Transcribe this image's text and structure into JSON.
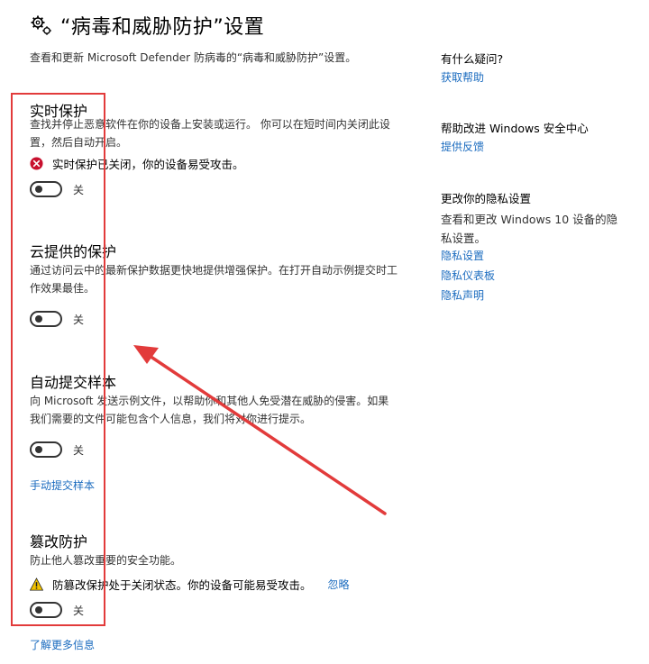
{
  "header": {
    "title": "“病毒和威胁防护”设置",
    "subtitle": "查看和更新 Microsoft Defender 防病毒的“病毒和威胁防护”设置。"
  },
  "sections": [
    {
      "title": "实时保护",
      "description": "查找并停止恶意软件在你的设备上安装或运行。 你可以在短时间内关闭此设置，然后自动开启。",
      "status": "实时保护已关闭，你的设备易受攻击。",
      "toggle_label": "关"
    },
    {
      "title": "云提供的保护",
      "description": "通过访问云中的最新保护数据更快地提供增强保护。在打开自动示例提交时工作效果最佳。",
      "toggle_label": "关"
    },
    {
      "title": "自动提交样本",
      "description": "向 Microsoft 发送示例文件，以帮助你和其他人免受潜在威胁的侵害。如果我们需要的文件可能包含个人信息，我们将对你进行提示。",
      "toggle_label": "关",
      "link": "手动提交样本"
    },
    {
      "title": "篡改防护",
      "description": "防止他人篡改重要的安全功能。",
      "status": "防篡改保护处于关闭状态。你的设备可能易受攻击。",
      "status_action": "忽略",
      "toggle_label": "关"
    }
  ],
  "footer_link": "了解更多信息",
  "sidebar": {
    "help_heading": "有什么疑问?",
    "help_link": "获取帮助",
    "improve_heading": "帮助改进 Windows 安全中心",
    "improve_link": "提供反馈",
    "privacy_heading": "更改你的隐私设置",
    "privacy_text": "查看和更改 Windows 10 设备的隐私设置。",
    "privacy_links": [
      "隐私设置",
      "隐私仪表板",
      "隐私声明"
    ]
  },
  "colors": {
    "link": "#1a6bbf",
    "error": "#c8102e",
    "warning": "#f2c200",
    "annotation": "#e23b3b"
  }
}
